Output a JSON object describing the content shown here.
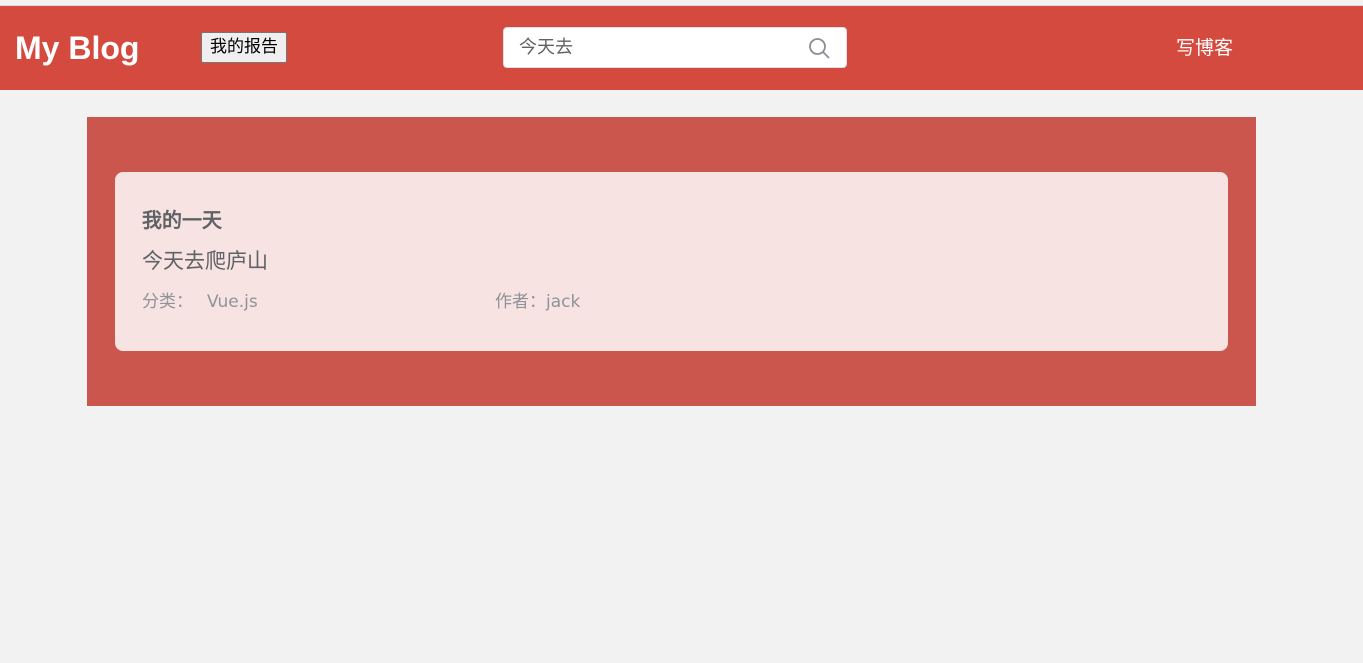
{
  "header": {
    "brand": "My Blog",
    "report_button": "我的报告",
    "search_value": "今天去",
    "write_link": "写博客",
    "search_icon": "search-icon"
  },
  "post": {
    "title": "我的一天",
    "summary": "今天去爬庐山",
    "category_label": "分类：",
    "category_value": "Vue.js",
    "author_label": "作者：",
    "author_value": "jack"
  },
  "colors": {
    "header_bg": "#d44a3f",
    "panel_bg": "#cb564d",
    "card_bg": "#f6e3e2",
    "page_bg": "#f2f2f2"
  }
}
